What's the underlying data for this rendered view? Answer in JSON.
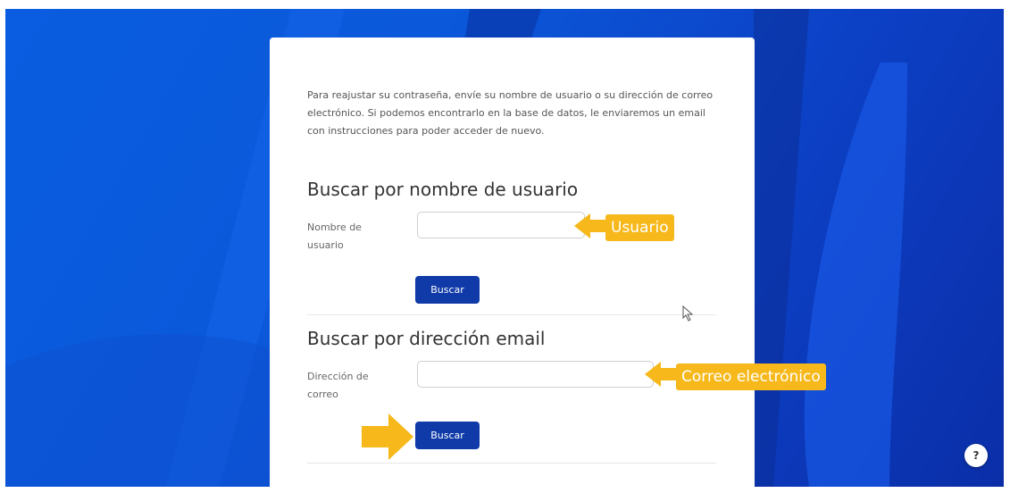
{
  "form": {
    "intro_text": "Para reajustar su contraseña, envíe su nombre de usuario o su dirección de correo electrónico. Si podemos encontrarlo en la base de datos, le enviaremos un email con instrucciones para poder acceder de nuevo.",
    "username_section": {
      "title": "Buscar por nombre de usuario",
      "label": "Nombre de usuario",
      "value": "",
      "button_label": "Buscar"
    },
    "email_section": {
      "title": "Buscar por dirección email",
      "label": "Dirección de correo",
      "value": "",
      "button_label": "Buscar"
    }
  },
  "annotations": {
    "username_callout": "Usuario",
    "email_callout": "Correo electrónico",
    "callout_color": "#f6b81a"
  },
  "help": {
    "label": "?"
  },
  "colors": {
    "button": "#0f3aa8",
    "background": "#0b58da"
  },
  "icons": {
    "help": "question-mark-icon",
    "cursor": "mouse-pointer-icon",
    "arrows": "left-arrow-icon"
  }
}
